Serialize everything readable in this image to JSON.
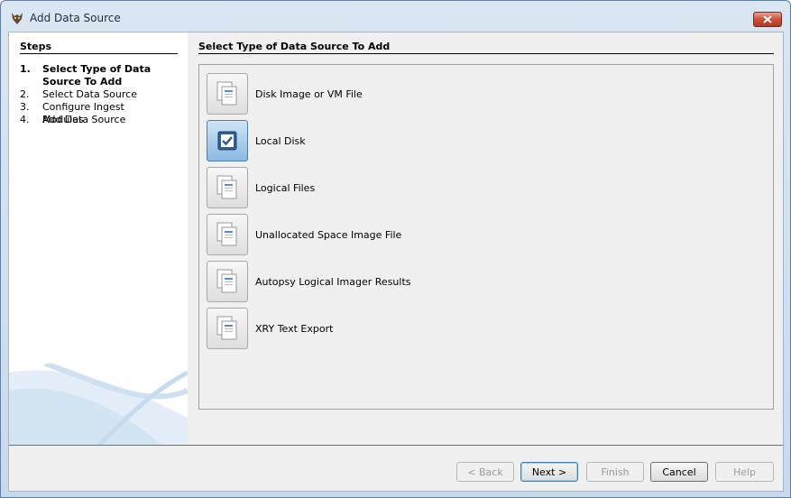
{
  "window": {
    "title": "Add Data Source"
  },
  "steps": {
    "heading": "Steps",
    "items": [
      {
        "num": "1.",
        "label": "Select Type of Data Source To Add"
      },
      {
        "num": "2.",
        "label": "Select Data Source"
      },
      {
        "num": "3.",
        "label": "Configure Ingest Modules"
      },
      {
        "num": "4.",
        "label": "Add Data Source"
      }
    ]
  },
  "main": {
    "heading": "Select Type of Data Source To Add",
    "options": [
      {
        "label": "Disk Image or VM File",
        "selected": false
      },
      {
        "label": "Local Disk",
        "selected": true
      },
      {
        "label": "Logical Files",
        "selected": false
      },
      {
        "label": "Unallocated Space Image File",
        "selected": false
      },
      {
        "label": "Autopsy Logical Imager Results",
        "selected": false
      },
      {
        "label": "XRY Text Export",
        "selected": false
      }
    ]
  },
  "buttons": {
    "back": "< Back",
    "next": "Next >",
    "finish": "Finish",
    "cancel": "Cancel",
    "help": "Help"
  }
}
